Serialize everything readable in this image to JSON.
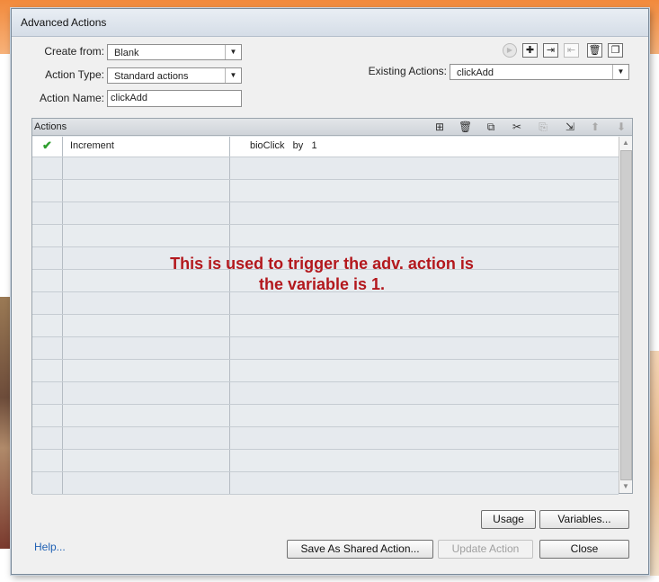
{
  "dialog": {
    "title": "Advanced Actions"
  },
  "form": {
    "create_from_label": "Create from:",
    "create_from_value": "Blank",
    "action_type_label": "Action Type:",
    "action_type_value": "Standard actions",
    "action_name_label": "Action Name:",
    "action_name_value": "clickAdd",
    "existing_actions_label": "Existing Actions:",
    "existing_actions_value": "clickAdd"
  },
  "toolbar_icons": [
    "play-icon",
    "add-icon",
    "import-icon",
    "export-icon",
    "delete-icon",
    "duplicate-icon"
  ],
  "actions_panel": {
    "header": "Actions",
    "header_icons": [
      "insert-row-icon",
      "trash-icon",
      "copy-icon",
      "cut-icon",
      "paste-icon",
      "insert-below-icon",
      "move-up-icon",
      "move-down-icon"
    ],
    "rows": [
      {
        "status": "✔",
        "action": "Increment",
        "target": "bioClick   by   1"
      }
    ],
    "empty_rows": 15
  },
  "annotation": {
    "line1": "This is used to trigger the adv. action is",
    "line2": "the variable is 1."
  },
  "buttons": {
    "usage": "Usage",
    "variables": "Variables...",
    "help": "Help...",
    "save_shared": "Save As Shared Action...",
    "update": "Update Action",
    "close": "Close"
  },
  "colors": {
    "annotation": "#b3181d",
    "check": "#2e9e2e",
    "link": "#2061b4"
  }
}
